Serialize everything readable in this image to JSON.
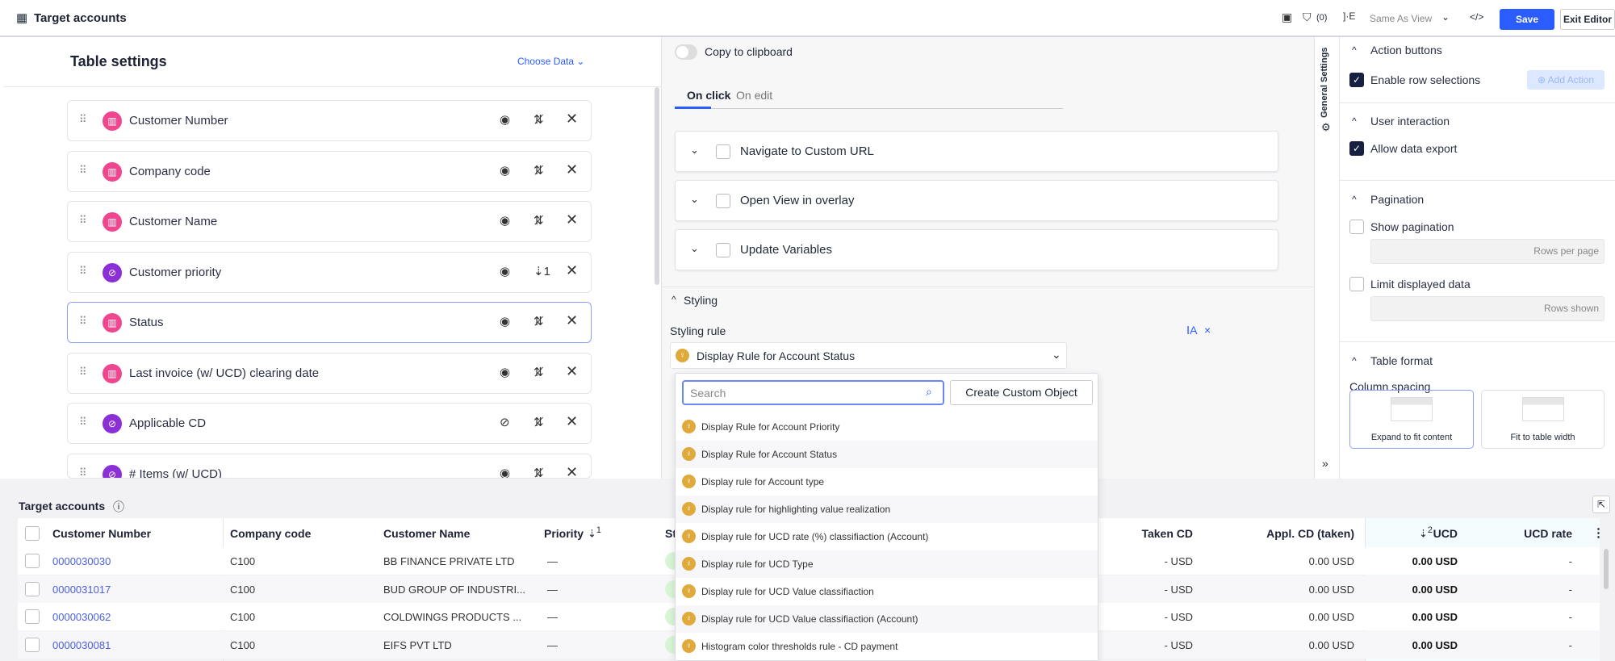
{
  "header": {
    "title": "Target accounts",
    "filter_count": "(0)",
    "view_select": "Same As View",
    "save": "Save",
    "exit": "Exit Editor"
  },
  "left": {
    "title": "Table settings",
    "choose_data": "Choose Data",
    "columns": [
      {
        "label": "Customer Number",
        "type": "dimension",
        "sort": "none",
        "visible": true
      },
      {
        "label": "Company code",
        "type": "dimension",
        "sort": "none",
        "visible": true
      },
      {
        "label": "Customer Name",
        "type": "dimension",
        "sort": "none",
        "visible": true
      },
      {
        "label": "Customer priority",
        "type": "kpi",
        "sort": "1",
        "visible": true
      },
      {
        "label": "Status",
        "type": "dimension",
        "sort": "none",
        "visible": true
      },
      {
        "label": "Last invoice (w/ UCD) clearing date",
        "type": "dimension",
        "sort": "none",
        "visible": true
      },
      {
        "label": "Applicable CD",
        "type": "kpi",
        "sort": "none",
        "visible": false
      },
      {
        "label": "# Items (w/ UCD)",
        "type": "kpi",
        "sort": "none",
        "visible": true
      }
    ]
  },
  "middle": {
    "copy_clipboard": "Copy to clipboard",
    "tabs": [
      "On click",
      "On edit"
    ],
    "actions": [
      "Navigate to Custom URL",
      "Open View in overlay",
      "Update Variables"
    ],
    "styling": "Styling",
    "styling_rule": "Styling rule",
    "selected_rule": "Display Rule for Account Status"
  },
  "dropdown": {
    "search_placeholder": "Search",
    "create": "Create Custom Object",
    "items": [
      "Display Rule for Account Priority",
      "Display Rule for Account Status",
      "Display rule for Account type",
      "Display rule for highlighting value realization",
      "Display rule for UCD rate (%) classifiaction (Account)",
      "Display rule for UCD Type",
      "Display rule for UCD Value classifiaction",
      "Display rule for UCD Value classifiaction (Account)",
      "Histogram color thresholds rule - CD payment"
    ]
  },
  "right": {
    "tab": "General Settings",
    "action_buttons": "Action buttons",
    "enable_rows": "Enable row selections",
    "add_action": "Add Action",
    "user_interaction": "User interaction",
    "allow_export": "Allow data export",
    "pagination": "Pagination",
    "show_pagination": "Show pagination",
    "rows_per_page": "Rows per page",
    "limit_data": "Limit displayed data",
    "rows_shown": "Rows shown",
    "table_format": "Table format",
    "column_spacing": "Column spacing",
    "expand": "Expand to fit content",
    "fit": "Fit to table width"
  },
  "table": {
    "title": "Target accounts",
    "headers": [
      "Customer Number",
      "Company code",
      "Customer Name",
      "Priority",
      "St",
      "Taken CD",
      "Appl. CD (taken)",
      "UCD",
      "UCD rate"
    ],
    "priority_sort": "1",
    "ucd_sort": "2",
    "rows": [
      [
        "0000030030",
        "C100",
        "BB FINANCE PRIVATE LTD",
        "—",
        "- USD",
        "0.00 USD",
        "0.00 USD",
        "-"
      ],
      [
        "0000031017",
        "C100",
        "BUD GROUP OF INDUSTRI...",
        "—",
        "- USD",
        "0.00 USD",
        "0.00 USD",
        "-"
      ],
      [
        "0000030062",
        "C100",
        "COLDWINGS PRODUCTS ...",
        "—",
        "- USD",
        "0.00 USD",
        "0.00 USD",
        "-"
      ],
      [
        "0000030081",
        "C100",
        "EIFS PVT LTD",
        "—",
        "- USD",
        "0.00 USD",
        "0.00 USD",
        "-"
      ]
    ]
  },
  "colors": {
    "accent": "#2b5cff",
    "dimension": "#f0468f",
    "kpi": "#8b2fd6",
    "rule": "#e0a93b"
  }
}
